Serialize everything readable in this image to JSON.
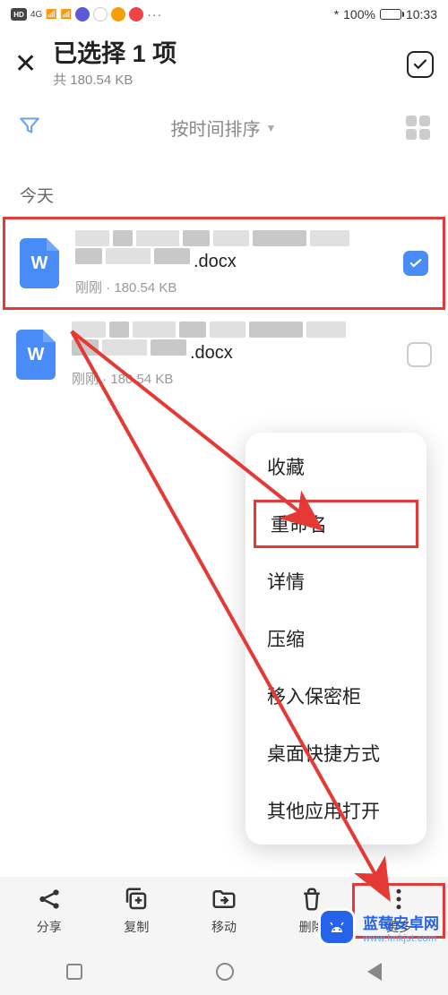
{
  "statusbar": {
    "hd": "HD",
    "net": "4G",
    "bt": "*",
    "battery_pct": "100%",
    "time": "10:33"
  },
  "header": {
    "title": "已选择 1 项",
    "subtitle": "共 180.54 KB"
  },
  "toolbar": {
    "sort_label": "按时间排序"
  },
  "section": {
    "today": "今天"
  },
  "files": [
    {
      "icon_letter": "W",
      "ext": ".docx",
      "meta": "刚刚 · 180.54 KB",
      "checked": true
    },
    {
      "icon_letter": "W",
      "ext": ".docx",
      "meta": "刚刚 · 180.54 KB",
      "checked": false
    }
  ],
  "popup": {
    "favorite": "收藏",
    "rename": "重命名",
    "details": "详情",
    "compress": "压缩",
    "vault": "移入保密柜",
    "shortcut": "桌面快捷方式",
    "openwith": "其他应用打开"
  },
  "bottom": {
    "share": "分享",
    "copy": "复制",
    "move": "移动",
    "delete": "删除",
    "more": "更多"
  },
  "watermark": {
    "main": "蓝莓安卓网",
    "sub": "www.lmkjst.com"
  }
}
